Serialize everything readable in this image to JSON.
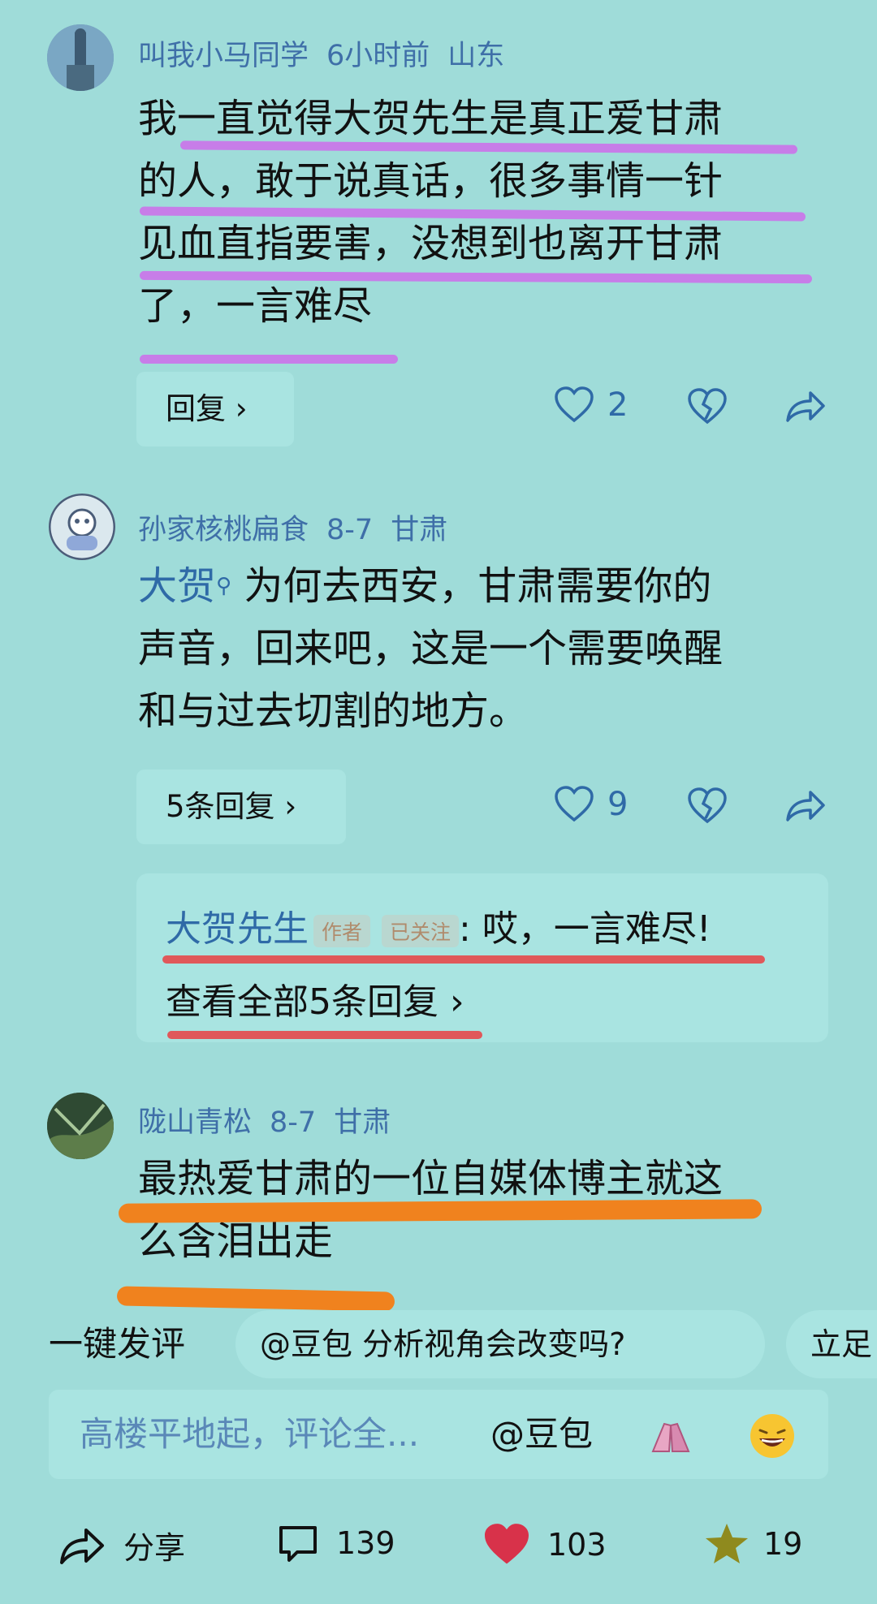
{
  "comments": [
    {
      "username": "叫我小马同学",
      "time": "6小时前",
      "location": "山东",
      "text_lines": [
        "我一直觉得大贺先生是真正爱甘肃",
        "的人，敢于说真话，很多事情一针",
        "见血直指要害，没想到也离开甘肃",
        "了，一言难尽"
      ],
      "reply_label": "回复",
      "likes": "2"
    },
    {
      "username": "孙家核桃扁食",
      "time": "8-7",
      "location": "甘肃",
      "mention": "大贺",
      "text_first_rest": "为何去西安，甘肃需要你的",
      "text_lines": [
        "声音，回来吧，这是一个需要唤醒",
        "和与过去切割的地方。"
      ],
      "reply_label": "5条回复",
      "likes": "9",
      "sub_reply": {
        "author": "大贺先生",
        "tag_author": "作者",
        "tag_follow": "已关注",
        "text": ": 哎，一言难尽!",
        "view_all": "查看全部5条回复"
      }
    },
    {
      "username": "陇山青松",
      "time": "8-7",
      "location": "甘肃",
      "text_lines": [
        "最热爱甘肃的一位自媒体博主就这",
        "么含泪出走"
      ]
    }
  ],
  "quick_comment": {
    "label": "一键发评",
    "chip1": "@豆包 分析视角会改变吗?",
    "chip2": "立足"
  },
  "input": {
    "placeholder": "高楼平地起，评论全...",
    "mention": "@豆包"
  },
  "bottom_bar": {
    "share_label": "分享",
    "comments": "139",
    "likes": "103",
    "stars": "19"
  },
  "colors": {
    "background": "#9fdcd9",
    "link_blue": "#2f6aa7",
    "underline_purple": "#c77de8",
    "underline_red": "#e0585a",
    "underline_orange": "#f0821e",
    "heart_red": "#d8324a",
    "star_olive": "#8f8a1e"
  }
}
